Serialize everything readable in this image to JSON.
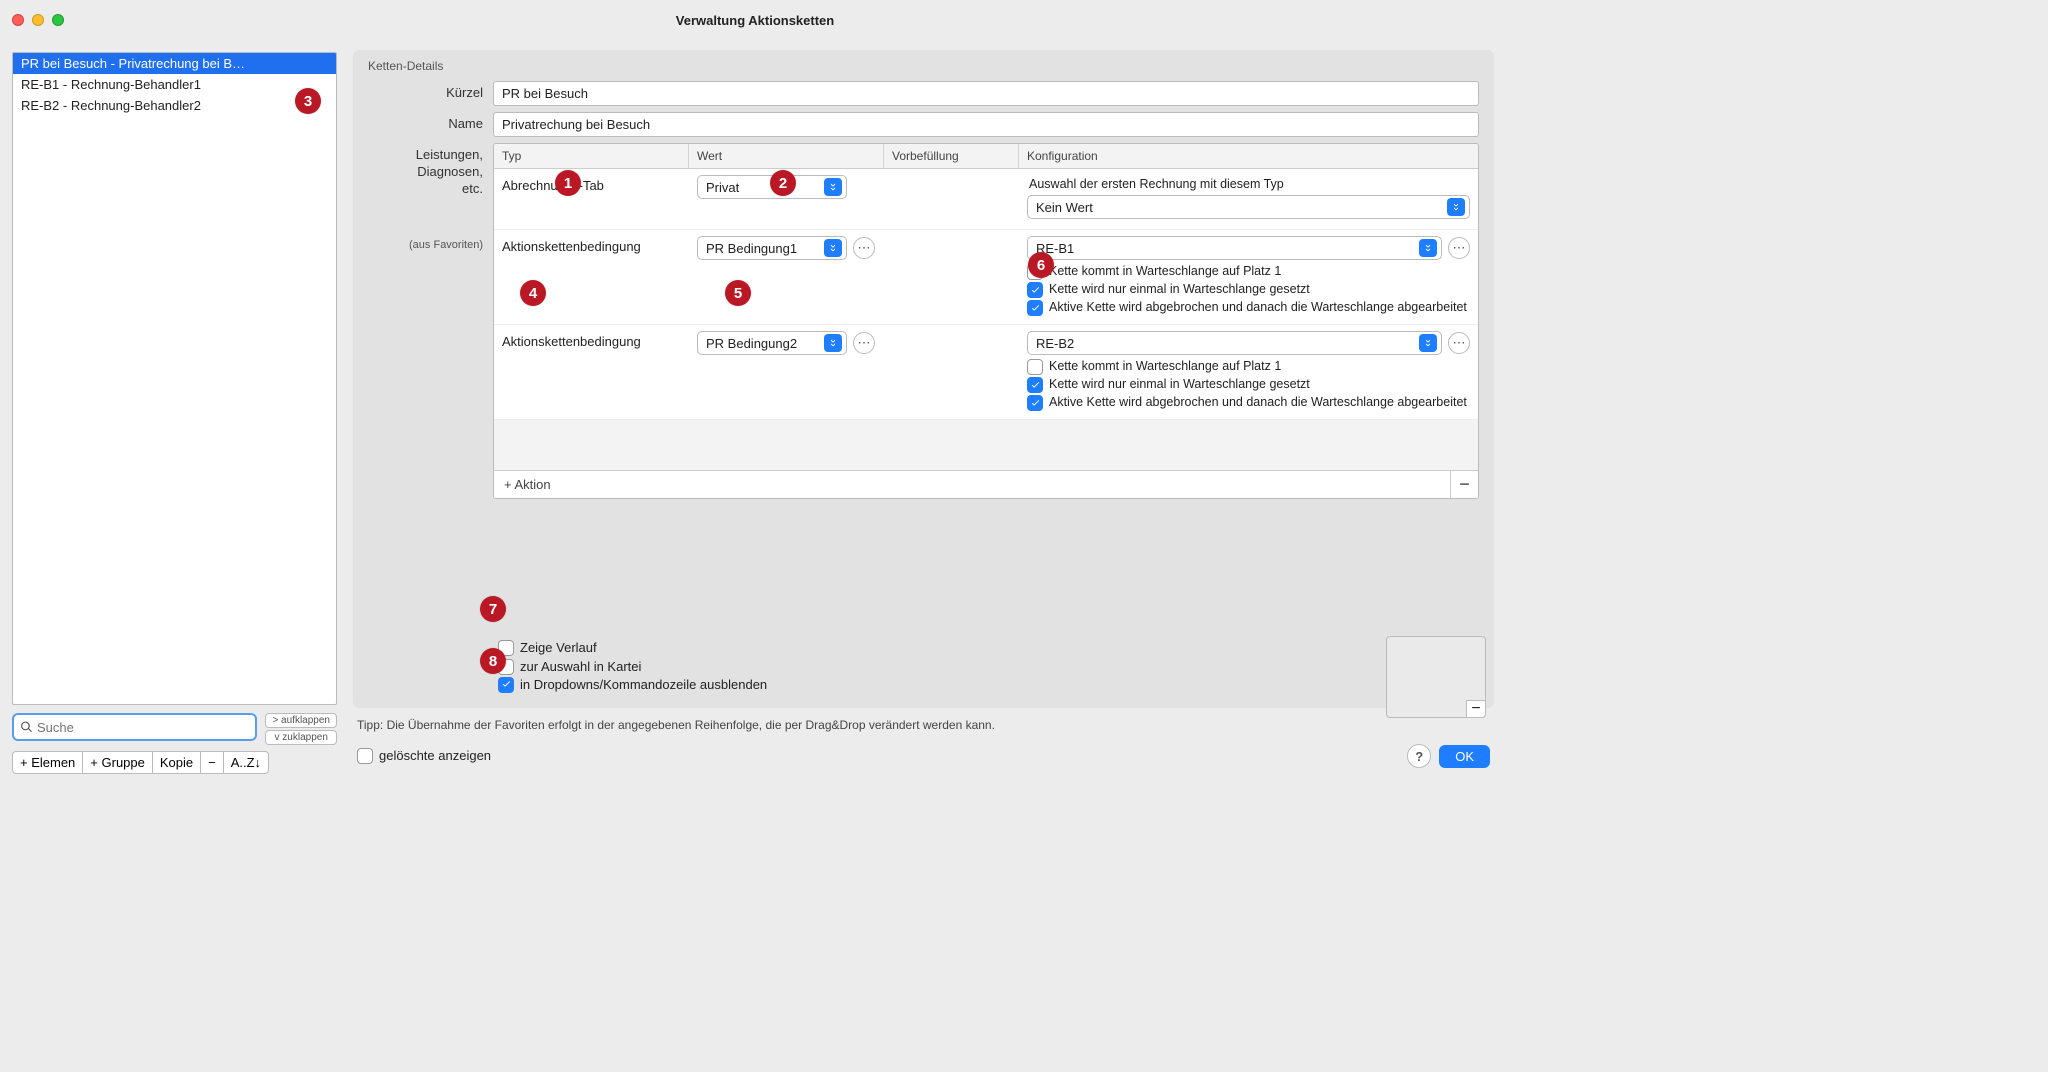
{
  "window": {
    "title": "Verwaltung Aktionsketten"
  },
  "sidebar": {
    "items": [
      "PR bei Besuch - Privatrechung bei B…",
      "RE-B1 - Rechnung-Behandler1",
      "RE-B2 - Rechnung-Behandler2"
    ],
    "search_placeholder": "Suche",
    "expand": "> aufklappen",
    "collapse": "v zuklappen",
    "toolbar": {
      "elem": "+ Elemen",
      "gruppe": "+ Gruppe",
      "kopie": "Kopie",
      "minus": "−",
      "sort": "A..Z↓"
    }
  },
  "details": {
    "group_label": "Ketten-Details",
    "kuerzel_label": "Kürzel",
    "kuerzel_value": "PR bei Besuch",
    "name_label": "Name",
    "name_value": "Privatrechung bei Besuch",
    "leistungen_label": "Leistungen,\nDiagnosen,\netc.",
    "favoriten_label": "(aus Favoriten)",
    "cols": {
      "typ": "Typ",
      "wert": "Wert",
      "vor": "Vorbefüllung",
      "konf": "Konfiguration"
    },
    "rows": [
      {
        "typ": "Abrechnungs-Tab",
        "wert": "Privat",
        "wert_select": true,
        "konf_desc": "Auswahl der ersten Rechnung mit diesem Typ",
        "konf_select": "Kein Wert",
        "checks": []
      },
      {
        "typ": "Aktionskettenbedingung",
        "wert": "PR Bedingung1",
        "wert_select": true,
        "wert_ellipsis": true,
        "konf_select": "RE-B1",
        "konf_ellipsis": true,
        "checks": [
          {
            "checked": false,
            "label": "Kette kommt in Warteschlange auf Platz 1"
          },
          {
            "checked": true,
            "label": "Kette wird nur einmal in Warteschlange gesetzt"
          },
          {
            "checked": true,
            "label": "Aktive Kette wird abgebrochen und danach die Warteschlange abgearbeitet"
          }
        ]
      },
      {
        "typ": "Aktionskettenbedingung",
        "wert": "PR Bedingung2",
        "wert_select": true,
        "wert_ellipsis": true,
        "konf_select": "RE-B2",
        "konf_ellipsis": true,
        "checks": [
          {
            "checked": false,
            "label": "Kette kommt in Warteschlange auf Platz 1"
          },
          {
            "checked": true,
            "label": "Kette wird nur einmal in Warteschlange gesetzt"
          },
          {
            "checked": true,
            "label": "Aktive Kette wird abgebrochen und danach die Warteschlange abgearbeitet"
          }
        ]
      }
    ],
    "add_label": "+ Aktion",
    "options": {
      "verlauf": "Zeige Verlauf",
      "kartei": "zur Auswahl in Kartei",
      "dropdown": "in Dropdowns/Kommandozeile ausblenden"
    }
  },
  "tip": "Tipp: Die Übernahme der Favoriten erfolgt in der angegebenen Reihenfolge, die per Drag&Drop verändert werden kann.",
  "footer": {
    "deleted": "gelöschte anzeigen",
    "help": "?",
    "ok": "OK"
  },
  "badges": [
    "1",
    "2",
    "3",
    "4",
    "5",
    "6",
    "7",
    "8"
  ]
}
